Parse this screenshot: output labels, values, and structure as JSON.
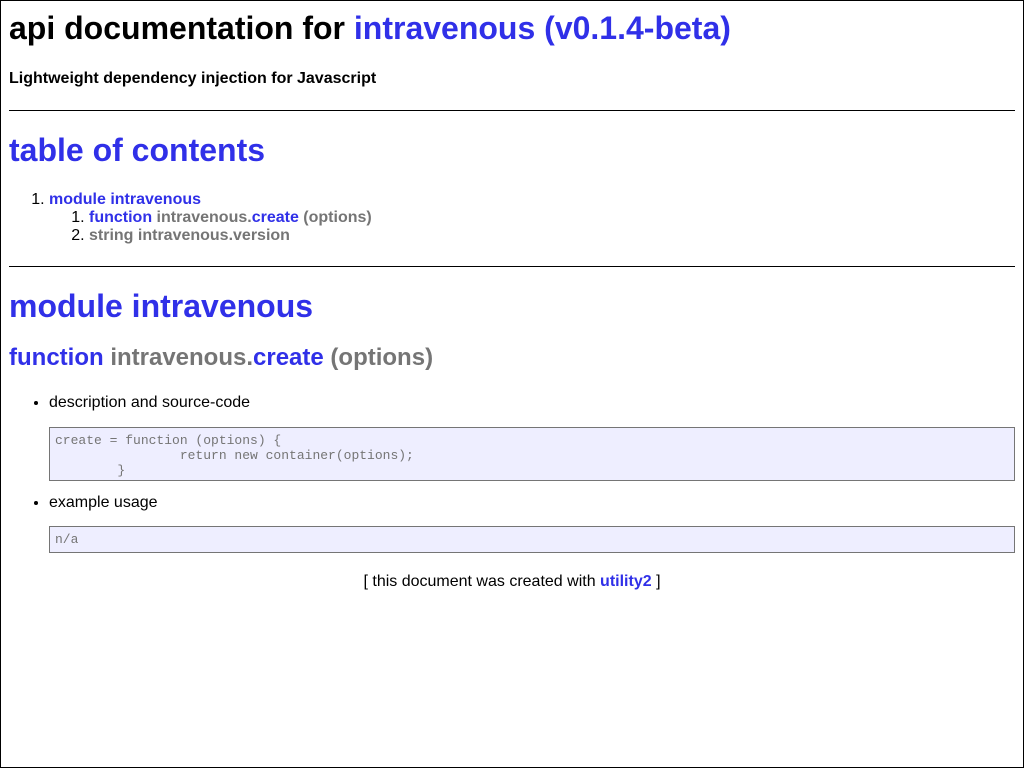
{
  "header": {
    "title_prefix": "api documentation for",
    "title_link": "intravenous (v0.1.4-beta)",
    "subtitle": "Lightweight dependency injection for Javascript"
  },
  "toc": {
    "heading": "table of contents",
    "module_link": "module intravenous",
    "items": [
      {
        "type": "function",
        "name_prefix": "intravenous.",
        "name": "create",
        "args": "(options)"
      },
      {
        "label": "string intravenous.version"
      }
    ]
  },
  "module": {
    "heading": "module intravenous",
    "function": {
      "type": "function",
      "name_prefix": "intravenous.",
      "name": "create",
      "args": "(options)"
    },
    "description_label": "description and source-code",
    "source_code": "create = function (options) {\n                return new container(options);\n        }",
    "example_label": "example usage",
    "example_code": "n/a"
  },
  "footer": {
    "prefix": "[ this document was created with",
    "link": "utility2",
    "suffix": "]"
  },
  "colors": {
    "link": "#3030e8",
    "muted": "#757575",
    "code_background": "#eeeeff"
  }
}
